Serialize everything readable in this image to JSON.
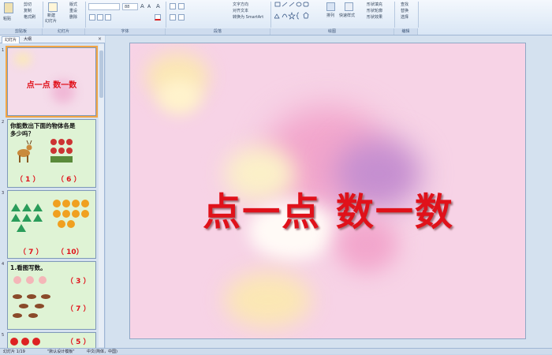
{
  "ribbon": {
    "clipboard": {
      "paste": "粘贴",
      "cut": "剪切",
      "copy": "复制",
      "format": "格式刷"
    },
    "slides": {
      "new": "新建",
      "new2": "幻灯片",
      "layout": "版式",
      "reset": "重设",
      "delete": "删除"
    },
    "font": {
      "size": "88",
      "grow": "A",
      "shrink": "A",
      "clear": "A"
    },
    "paragraph": {
      "text_dir": "文字方向",
      "align": "对齐文本",
      "smartart": "转换为 SmartArt"
    },
    "drawing": {
      "arrange": "排列",
      "quick": "快速样式",
      "fill": "形状填充",
      "outline": "形状轮廓",
      "effect": "形状效果"
    },
    "editing": {
      "find": "查找",
      "replace": "替换",
      "select": "选择"
    },
    "groups": {
      "clipboard": "剪贴板",
      "slides": "幻灯片",
      "font": "字体",
      "paragraph": "段落",
      "drawing": "绘图",
      "editing": "编辑"
    }
  },
  "panel": {
    "tab_slides": "幻灯片",
    "tab_outline": "大纲",
    "close": "×"
  },
  "thumbs": {
    "n1": "1",
    "n2": "2",
    "n3": "3",
    "n4": "4",
    "n5": "5",
    "t1_title": "点一点 数一数",
    "t2_q1": "你能数出下面的物体各是",
    "t2_q2": "多少吗？",
    "t2_a1": "（ 1 ）",
    "t2_a2": "（ 6 ）",
    "t3_a1": "（ 7 ）",
    "t3_a2": "（ 10）",
    "t4_title": "1.看图写数。",
    "t4_a1": "（ 3 ）",
    "t4_a2": "（ 7 ）",
    "t5_a1": "（ 5 ）"
  },
  "slide": {
    "title": "点一点  数一数"
  },
  "status": {
    "slide_info": "幻灯片 1/19",
    "theme": "\"默认设计模板\"",
    "lang": "中文(简体，中国)"
  },
  "colors": {
    "title": "#e0111a",
    "slide_bg": "#f7d3e6",
    "thumb_bg": "#dff3d5",
    "triangle": "#2a9c5a",
    "leaf": "#f0a020"
  }
}
